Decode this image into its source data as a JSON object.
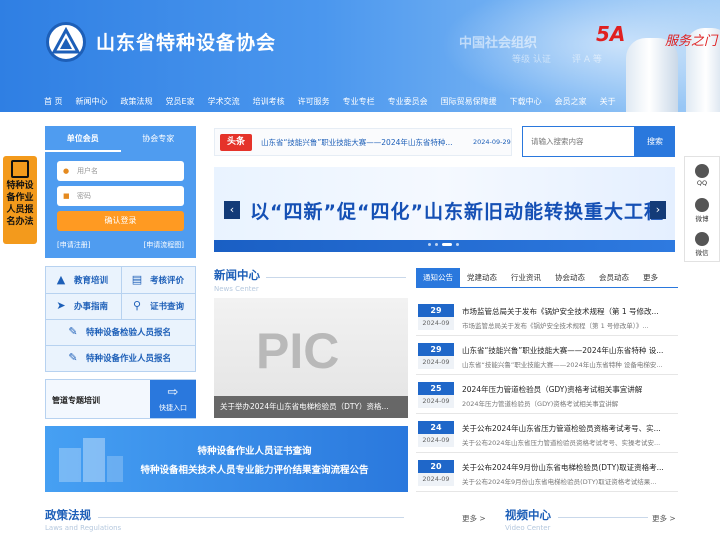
{
  "header": {
    "site_title": "山东省特种设备协会",
    "org_label": "中国社会组织",
    "org_sub": "等级 认证",
    "org_sub2": "评 A 等",
    "grade": "5A",
    "signature": "服务之门"
  },
  "nav": [
    "首 页",
    "新闻中心",
    "政策法规",
    "党员E家",
    "学术交流",
    "培训考核",
    "许可服务",
    "专业专栏",
    "专业委员会",
    "国际贸易保障援",
    "下载中心",
    "会员之家",
    "关于"
  ],
  "side_float": {
    "label": "特种设备作业人员报名办法"
  },
  "login": {
    "tab_member": "单位会员",
    "tab_expert": "协会专家",
    "username_placeholder": "用户名",
    "password_placeholder": "密码",
    "login_button": "确认登录",
    "register_link": "[申请注册]",
    "process_link": "[申请流程图]"
  },
  "quick_links": {
    "education": "教育培训",
    "evaluation": "考核评价",
    "guide": "办事指南",
    "cert_query": "证书查询",
    "inspector_signup": "特种设备检验人员报名",
    "operator_signup": "特种设备作业人员报名"
  },
  "pipeline": {
    "label": "管道专题培训",
    "button": "快捷入口"
  },
  "headline": {
    "badge": "头条",
    "text": "山东省“技能兴鲁”职业技能大赛——2024年山东省特种...",
    "date": "2024-09-29"
  },
  "search": {
    "placeholder": "请输入搜索内容",
    "button": "搜索"
  },
  "banner": {
    "text": "以“四新”促“四化”山东新旧动能转换重大工程",
    "prev": "‹",
    "next": "›"
  },
  "social": {
    "qq": "QQ",
    "weibo": "微博",
    "wechat": "微信"
  },
  "news_center": {
    "title": "新闻中心",
    "subtitle": "News Center",
    "pic_text": "PIC",
    "pic_caption": "关于举办2024年山东省电梯检验员（DTY）资格..."
  },
  "tabs": [
    "通知公告",
    "党建动态",
    "行业资讯",
    "协会动态",
    "会员动态",
    "更多"
  ],
  "news_list": [
    {
      "day": "29",
      "ym": "2024-09",
      "title": "市场监管总局关于发布《锅炉安全技术规程（第 1 号修改...",
      "desc": "市场监管总局关于发布《锅炉安全技术规程（第 1 号修改单）》..."
    },
    {
      "day": "29",
      "ym": "2024-09",
      "title": "山东省“技能兴鲁”职业技能大赛——2024年山东省特种 设...",
      "desc": "山东省“技能兴鲁”职业技能大赛——2024年山东省特种 设备电梯安..."
    },
    {
      "day": "25",
      "ym": "2024-09",
      "title": "2024年压力管道检验员（GDY)资格考试相关事宜讲解",
      "desc": "2024年压力管道检验员（GDY)资格考试相关事宜讲解"
    },
    {
      "day": "24",
      "ym": "2024-09",
      "title": "关于公布2024年山东省压力管道检验员资格考试考号、实...",
      "desc": "关于公布2024年山东省压力管道检验员资格考试考号、实操考试安..."
    },
    {
      "day": "20",
      "ym": "2024-09",
      "title": "关于公布2024年9月份山东省电梯检验员(DTY)取证资格考...",
      "desc": "关于公布2024年9月份山东省电梯检验员(DTY)取证资格考试结果..."
    }
  ],
  "cert_banner": {
    "line1": "特种设备作业人员证书查询",
    "line2": "特种设备相关技术人员专业能力评价结果查询流程公告"
  },
  "policy": {
    "title": "政策法规",
    "subtitle": "Laws and Regulations",
    "more": "更多 >"
  },
  "video": {
    "title": "视频中心",
    "subtitle": "Video Center",
    "more": "更多 >"
  },
  "colors": {
    "primary": "#2a78dd",
    "accent": "#ff9a22",
    "headline": "#e5332a"
  }
}
